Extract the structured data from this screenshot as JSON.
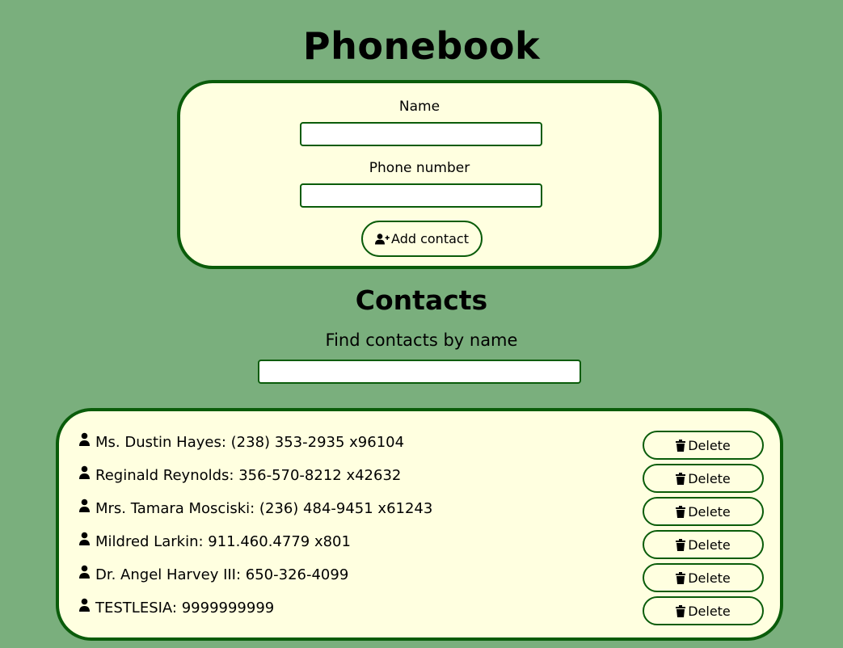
{
  "header": {
    "title": "Phonebook"
  },
  "form": {
    "name_label": "Name",
    "name_value": "",
    "phone_label": "Phone number",
    "phone_value": "",
    "add_button_label": "Add contact"
  },
  "contacts": {
    "title": "Contacts",
    "filter_label": "Find contacts by name",
    "filter_value": "",
    "delete_label": "Delete",
    "items": [
      {
        "text": "Ms. Dustin Hayes: (238) 353-2935 x96104"
      },
      {
        "text": "Reginald Reynolds: 356-570-8212 x42632"
      },
      {
        "text": "Mrs. Tamara Mosciski: (236) 484-9451 x61243"
      },
      {
        "text": "Mildred Larkin: 911.460.4779 x801"
      },
      {
        "text": "Dr. Angel Harvey III: 650-326-4099"
      },
      {
        "text": "TESTLESIA: 9999999999"
      }
    ]
  },
  "colors": {
    "background": "#7aaf7d",
    "card": "#ffffe0",
    "border": "#0a5c0a"
  },
  "icons": {
    "add_button_icon": "user-plus-icon",
    "contact_icon": "user-icon",
    "delete_icon": "trash-icon"
  }
}
